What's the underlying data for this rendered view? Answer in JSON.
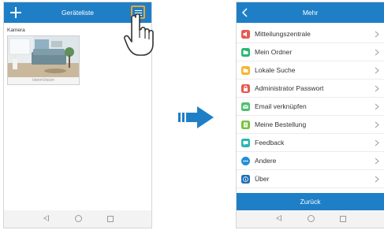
{
  "left_screen": {
    "title": "Geräteliste",
    "section_label": "Kamera",
    "camera_name": "HeimVision",
    "icons": {
      "add": "plus-icon",
      "menu": "hamburger-menu-icon",
      "pointer": "hand-pointer-icon"
    }
  },
  "transition_arrow": {
    "icon": "right-arrow-icon",
    "color": "#1f7fc6"
  },
  "right_screen": {
    "title": "Mehr",
    "menu_items": [
      {
        "label": "Mitteilungszentrale",
        "icon": "notification-icon",
        "color": "#e8584f"
      },
      {
        "label": "Mein Ordner",
        "icon": "folder-icon",
        "color": "#2bb673"
      },
      {
        "label": "Lokale Suche",
        "icon": "search-folder-icon",
        "color": "#f5b52e"
      },
      {
        "label": "Administrator Passwort",
        "icon": "lock-icon",
        "color": "#e8584f"
      },
      {
        "label": "Email verknüpfen",
        "icon": "email-icon",
        "color": "#4cbf6e"
      },
      {
        "label": "Meine Bestellung",
        "icon": "order-icon",
        "color": "#7ac143"
      },
      {
        "label": "Feedback",
        "icon": "feedback-icon",
        "color": "#2ab6b0"
      },
      {
        "label": "Andere",
        "icon": "more-icon",
        "color": "#1f8fd6"
      },
      {
        "label": "Über",
        "icon": "info-icon",
        "color": "#1f6fb6"
      }
    ],
    "back_button": "Zurück"
  },
  "colors": {
    "header": "#1f7fc6",
    "highlight": "#f2a22f"
  }
}
